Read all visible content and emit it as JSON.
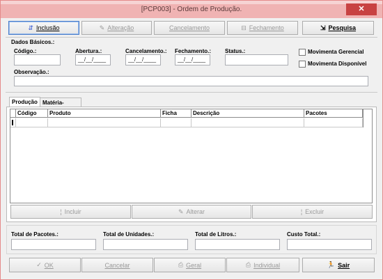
{
  "window": {
    "title": "[PCP003] - Ordem de Produção.",
    "close_glyph": "✕"
  },
  "toolbar": {
    "inclusao": "Inclusão",
    "alteracao": "Alteração",
    "cancelamento": "Cancelamento",
    "fechamento": "Fechamento",
    "pesquisa": "Pesquisa"
  },
  "basic": {
    "section": "Dados Básicos.:",
    "codigo_label": "Código.:",
    "abertura_label": "Abertura.:",
    "cancelamento_label": "Cancelamento.:",
    "fechamento_label": "Fechamento.:",
    "status_label": "Status.:",
    "observacao_label": "Observação.:",
    "date_mask": "__/__/____",
    "movimenta_gerencial": "Movimenta Gerencial",
    "movimenta_disponivel": "Movimenta Disponível"
  },
  "tabs": [
    "Produção",
    "Matéria-Prima"
  ],
  "grid": {
    "columns": [
      "Código",
      "Produto",
      "Ficha",
      "Descrição",
      "Pacotes"
    ]
  },
  "grid_buttons": {
    "incluir": "Incluir",
    "alterar": "Alterar",
    "excluir": "Excluir"
  },
  "totals": {
    "pacotes": "Total de Pacotes.:",
    "unidades": "Total de Unidades.:",
    "litros": "Total de Litros.:",
    "custo": "Custo Total.:"
  },
  "bottom": {
    "ok": "OK",
    "cancelar": "Cancelar",
    "geral": "Geral",
    "individual": "Individual",
    "sair": "Sair"
  },
  "colors": {
    "title_bar": "#f0b3b3",
    "close": "#c84242",
    "focus_border": "#4a7ecb",
    "window_bg": "#f0f0f0"
  },
  "icons": [
    "new-doc-icon",
    "edit-icon",
    "close-doc-icon",
    "search-icon",
    "check-icon",
    "print-icon",
    "print-individual-icon",
    "exit-icon"
  ]
}
